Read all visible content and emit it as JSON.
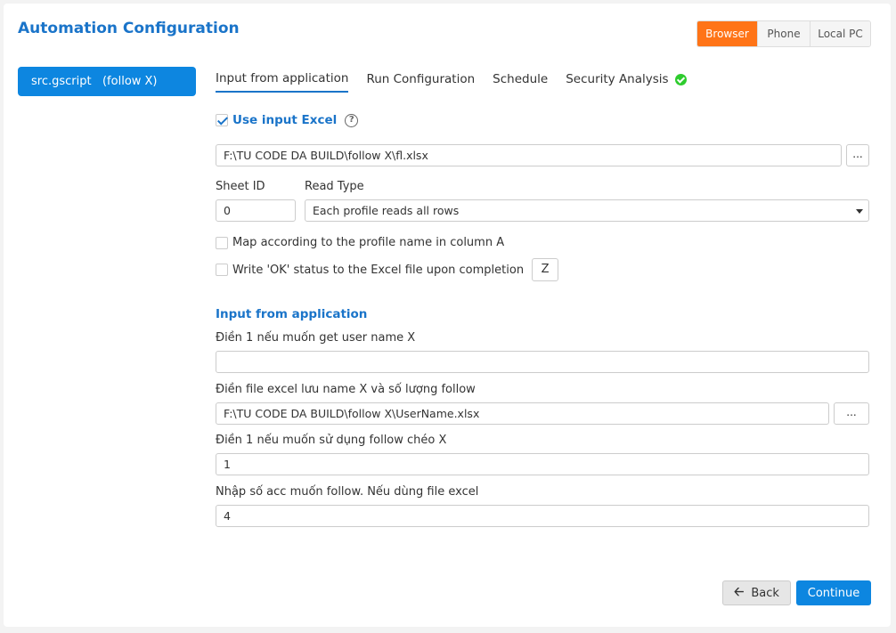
{
  "header": {
    "title": "Automation Configuration",
    "env_options": [
      "Browser",
      "Phone",
      "Local PC"
    ],
    "env_selected": "Browser"
  },
  "sidebar": {
    "script_item": "src.gscript   (follow X)"
  },
  "tabs": [
    {
      "label": "Input from application",
      "active": true
    },
    {
      "label": "Run Configuration",
      "active": false
    },
    {
      "label": "Schedule",
      "active": false
    },
    {
      "label": "Security Analysis",
      "active": false,
      "status_icon": "check-circle-icon"
    }
  ],
  "excel": {
    "use_input_label": "Use input Excel",
    "use_input_checked": true,
    "file_path": "F:\\TU CODE DA BUILD\\follow X\\fl.xlsx",
    "browse_label": "...",
    "sheet_id_label": "Sheet ID",
    "sheet_id_value": "0",
    "read_type_label": "Read Type",
    "read_type_value": "Each profile reads all rows",
    "map_label": "Map according to the profile name in column A",
    "map_checked": false,
    "write_ok_label": "Write 'OK' status to the Excel file upon completion",
    "write_ok_checked": false,
    "write_ok_column": "Z"
  },
  "app_inputs": {
    "section_title": "Input from application",
    "fields": [
      {
        "label": "Điền 1 nếu muốn get user name X",
        "value": ""
      },
      {
        "label": "Điền file excel lưu name X và số lượng follow",
        "value": "F:\\TU CODE DA BUILD\\follow X\\UserName.xlsx",
        "browse_label": "..."
      },
      {
        "label": "Điền 1 nếu muốn sử dụng follow chéo X",
        "value": "1"
      },
      {
        "label": "Nhập số acc muốn follow. Nếu dùng file excel",
        "value": "4"
      }
    ]
  },
  "footer": {
    "back_label": "Back",
    "continue_label": "Continue"
  },
  "colors": {
    "accent": "#1a74c9",
    "primary_button": "#0d86e0",
    "env_active": "#ff7417",
    "success": "#2ecc2e"
  }
}
